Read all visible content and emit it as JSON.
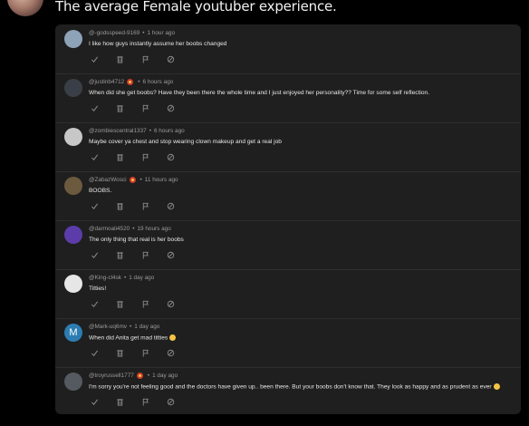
{
  "post": {
    "text": "The average Female youtuber experience."
  },
  "comments": [
    {
      "handle": "@-godsspeed-9169",
      "time": "1 hour ago",
      "badge": false,
      "text": "I like how guys instantly assume her boobs changed",
      "avatar_color": "#8ea2b8",
      "avatar_letter": "",
      "emoji": false
    },
    {
      "handle": "@justinb4712",
      "time": "6 hours ago",
      "badge": true,
      "text": "When did she get boobs?  Have they been there the whole time and I just enjoyed her personality??  Time for some self reflection.",
      "avatar_color": "#3a3f47",
      "avatar_letter": "",
      "emoji": false
    },
    {
      "handle": "@zombiescentral1337",
      "time": "6 hours ago",
      "badge": false,
      "text": "Maybe cover ya chest and stop wearing clown makeup and get a real job",
      "avatar_color": "#c7c7c7",
      "avatar_letter": "",
      "emoji": false
    },
    {
      "handle": "@ZabazWosci",
      "time": "11 hours ago",
      "badge": true,
      "text": "BOOBS.",
      "avatar_color": "#6c5a3f",
      "avatar_letter": "",
      "emoji": false
    },
    {
      "handle": "@darmoali4520",
      "time": "19 hours ago",
      "badge": false,
      "text": "The only thing that real is her boobs",
      "avatar_color": "#5b3ca8",
      "avatar_letter": "",
      "emoji": false
    },
    {
      "handle": "@King-cl4sk",
      "time": "1 day ago",
      "badge": false,
      "text": "Titties!",
      "avatar_color": "#e6e6e6",
      "avatar_letter": "",
      "emoji": false
    },
    {
      "handle": "@Mark-uq6mv",
      "time": "1 day ago",
      "badge": false,
      "text": "When did Anita get mad titties",
      "avatar_color": "#2d7db3",
      "avatar_letter": "M",
      "emoji": true
    },
    {
      "handle": "@troyrussell1777",
      "time": "1 day ago",
      "badge": true,
      "text": "I'm sorry you're not feeling good and the doctors have given up.. been there. But your boobs don't know that. They look as happy and as prudent as ever",
      "avatar_color": "#555a60",
      "avatar_letter": "",
      "emoji": true
    }
  ],
  "separator": "•",
  "icons": [
    "checkmark-icon",
    "trash-icon",
    "flag-icon",
    "block-icon"
  ]
}
